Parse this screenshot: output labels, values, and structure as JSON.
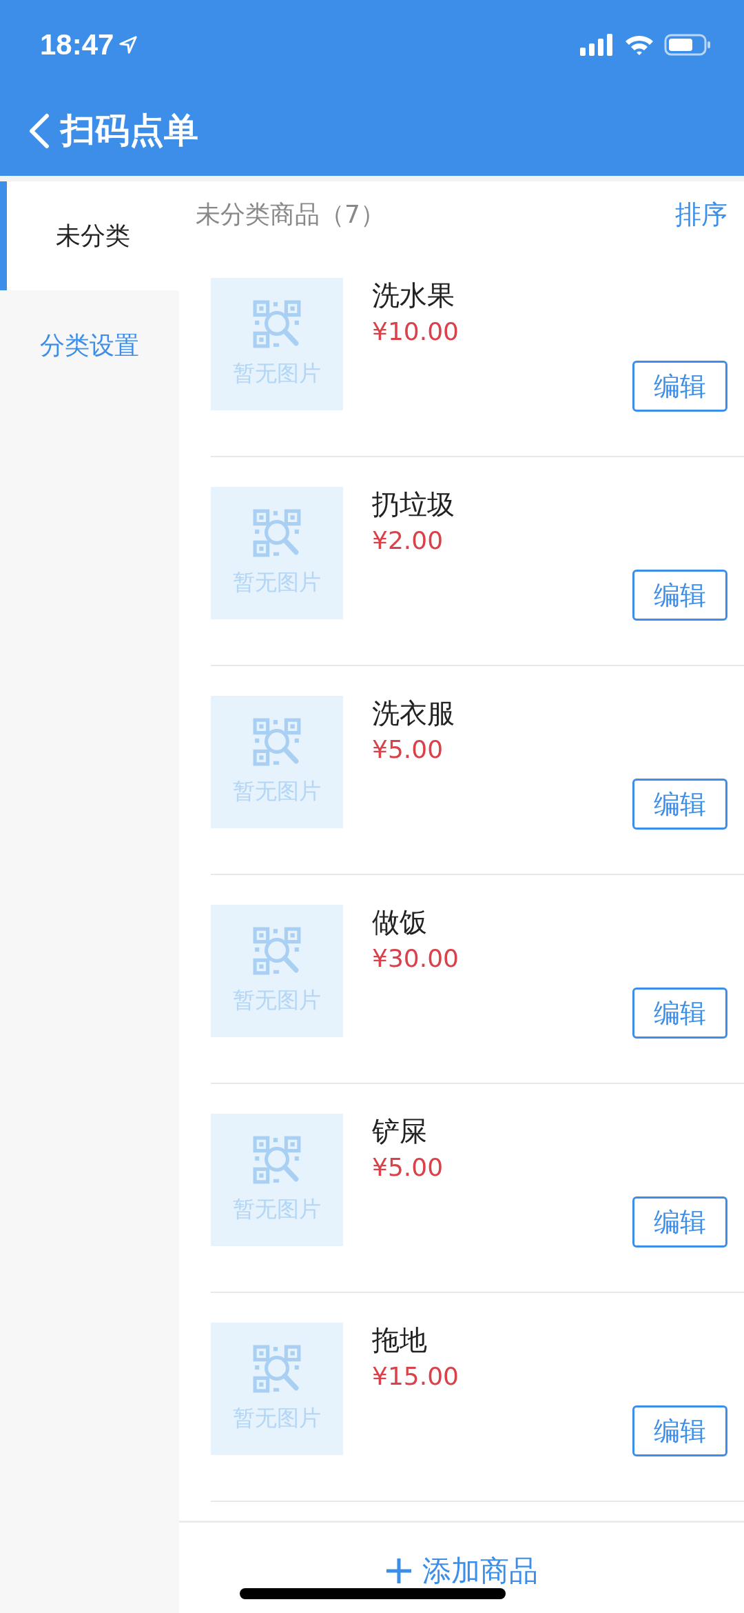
{
  "status_bar": {
    "time": "18:47"
  },
  "header": {
    "title": "扫码点单"
  },
  "sidebar": {
    "items": [
      {
        "label": "未分类",
        "selected": true,
        "kind": "category"
      },
      {
        "label": "分类设置",
        "selected": false,
        "kind": "link"
      }
    ]
  },
  "list": {
    "title": "未分类商品（7）",
    "sort_label": "排序",
    "items": [
      {
        "name": "洗水果",
        "price": "¥10.00",
        "image_label": "暂无图片",
        "button": "编辑"
      },
      {
        "name": "扔垃圾",
        "price": "¥2.00",
        "image_label": "暂无图片",
        "button": "编辑"
      },
      {
        "name": "洗衣服",
        "price": "¥5.00",
        "image_label": "暂无图片",
        "button": "编辑"
      },
      {
        "name": "做饭",
        "price": "¥30.00",
        "image_label": "暂无图片",
        "button": "编辑"
      },
      {
        "name": "铲屎",
        "price": "¥5.00",
        "image_label": "暂无图片",
        "button": "编辑"
      },
      {
        "name": "拖地",
        "price": "¥15.00",
        "image_label": "暂无图片",
        "button": "编辑"
      }
    ]
  },
  "footer": {
    "add_button": "添加商品"
  }
}
